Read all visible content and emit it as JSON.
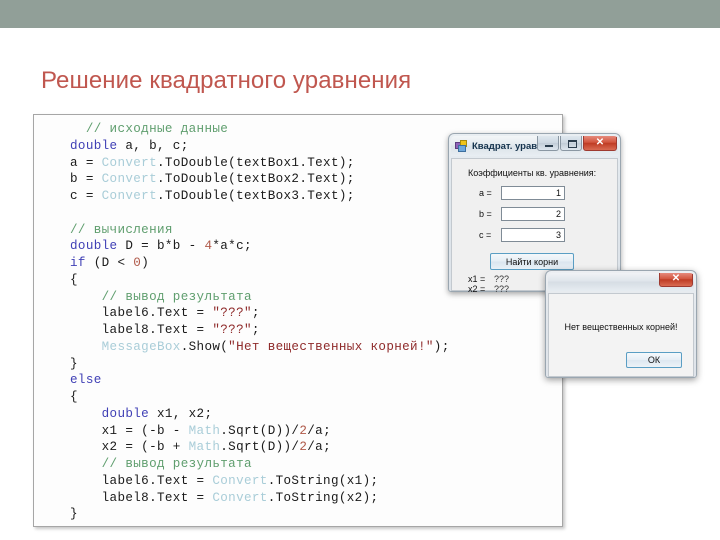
{
  "slide": {
    "title": "Решение квадратного уравнения",
    "title_color": "#c0574f",
    "band_color": "#919f98"
  },
  "code": {
    "language": "csharp",
    "lines": [
      [
        {
          "t": "  ",
          "c": "pl"
        },
        {
          "t": "// исходные данные",
          "c": "cm"
        }
      ],
      [
        {
          "t": "double",
          "c": "kw"
        },
        {
          "t": " a, b, c;",
          "c": "pl"
        }
      ],
      [
        {
          "t": "a = ",
          "c": "pl"
        },
        {
          "t": "Convert",
          "c": "ty"
        },
        {
          "t": ".ToDouble(textBox1.Text);",
          "c": "pl"
        }
      ],
      [
        {
          "t": "b = ",
          "c": "pl"
        },
        {
          "t": "Convert",
          "c": "ty"
        },
        {
          "t": ".ToDouble(textBox2.Text);",
          "c": "pl"
        }
      ],
      [
        {
          "t": "c = ",
          "c": "pl"
        },
        {
          "t": "Convert",
          "c": "ty"
        },
        {
          "t": ".ToDouble(textBox3.Text);",
          "c": "pl"
        }
      ],
      [
        {
          "t": "",
          "c": "pl"
        }
      ],
      [
        {
          "t": "// вычисления",
          "c": "cm"
        }
      ],
      [
        {
          "t": "double",
          "c": "kw"
        },
        {
          "t": " D = b*b - ",
          "c": "pl"
        },
        {
          "t": "4",
          "c": "num"
        },
        {
          "t": "*a*c;",
          "c": "pl"
        }
      ],
      [
        {
          "t": "if",
          "c": "kw"
        },
        {
          "t": " (D < ",
          "c": "pl"
        },
        {
          "t": "0",
          "c": "num"
        },
        {
          "t": ")",
          "c": "pl"
        }
      ],
      [
        {
          "t": "{",
          "c": "pl"
        }
      ],
      [
        {
          "t": "    ",
          "c": "pl"
        },
        {
          "t": "// вывод результата",
          "c": "cm"
        }
      ],
      [
        {
          "t": "    label6.Text = ",
          "c": "pl"
        },
        {
          "t": "\"???\"",
          "c": "st"
        },
        {
          "t": ";",
          "c": "pl"
        }
      ],
      [
        {
          "t": "    label8.Text = ",
          "c": "pl"
        },
        {
          "t": "\"???\"",
          "c": "st"
        },
        {
          "t": ";",
          "c": "pl"
        }
      ],
      [
        {
          "t": "    ",
          "c": "pl"
        },
        {
          "t": "MessageBox",
          "c": "ty"
        },
        {
          "t": ".Show(",
          "c": "pl"
        },
        {
          "t": "\"Нет вещественных корней!\"",
          "c": "st"
        },
        {
          "t": ");",
          "c": "pl"
        }
      ],
      [
        {
          "t": "}",
          "c": "pl"
        }
      ],
      [
        {
          "t": "else",
          "c": "kw"
        }
      ],
      [
        {
          "t": "{",
          "c": "pl"
        }
      ],
      [
        {
          "t": "    ",
          "c": "pl"
        },
        {
          "t": "double",
          "c": "kw"
        },
        {
          "t": " x1, x2;",
          "c": "pl"
        }
      ],
      [
        {
          "t": "    x1 = (-b - ",
          "c": "pl"
        },
        {
          "t": "Math",
          "c": "ty"
        },
        {
          "t": ".Sqrt(D))/",
          "c": "pl"
        },
        {
          "t": "2",
          "c": "num"
        },
        {
          "t": "/a;",
          "c": "pl"
        }
      ],
      [
        {
          "t": "    x2 = (-b + ",
          "c": "pl"
        },
        {
          "t": "Math",
          "c": "ty"
        },
        {
          "t": ".Sqrt(D))/",
          "c": "pl"
        },
        {
          "t": "2",
          "c": "num"
        },
        {
          "t": "/a;",
          "c": "pl"
        }
      ],
      [
        {
          "t": "    ",
          "c": "pl"
        },
        {
          "t": "// вывод результата",
          "c": "cm"
        }
      ],
      [
        {
          "t": "    label6.Text = ",
          "c": "pl"
        },
        {
          "t": "Convert",
          "c": "ty"
        },
        {
          "t": ".ToString(x1);",
          "c": "pl"
        }
      ],
      [
        {
          "t": "    label8.Text = ",
          "c": "pl"
        },
        {
          "t": "Convert",
          "c": "ty"
        },
        {
          "t": ".ToString(x2);",
          "c": "pl"
        }
      ],
      [
        {
          "t": "}",
          "c": "pl"
        }
      ]
    ]
  },
  "form": {
    "title": "Квадрат. уравн...",
    "app_icon": "visual-studio-form-icon",
    "minimize_label": "",
    "maximize_label": "",
    "close_label": "✕",
    "heading": "Коэффициенты кв. уравнения:",
    "coefficients": [
      {
        "label": "a =",
        "value": "1"
      },
      {
        "label": "b =",
        "value": "2"
      },
      {
        "label": "c =",
        "value": "3"
      }
    ],
    "action_button": "Найти корни",
    "roots": [
      {
        "name": "x1 =",
        "value": "???"
      },
      {
        "name": "x2 =",
        "value": "???"
      }
    ]
  },
  "messagebox": {
    "title": "",
    "close_label": "✕",
    "message": "Нет вещественных корней!",
    "ok_label": "ОК"
  }
}
